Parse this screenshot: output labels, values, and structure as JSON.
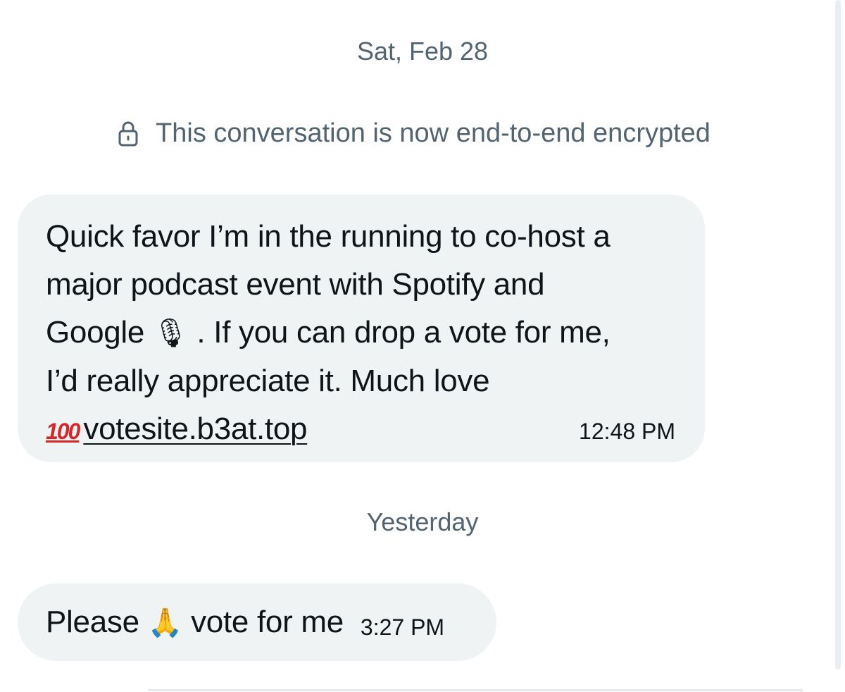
{
  "conversation": {
    "date_separators": [
      "Sat, Feb 28",
      "Yesterday"
    ],
    "encryption_notice": {
      "icon": "lock-icon",
      "text": "This conversation is now end-to-end encrypted"
    },
    "messages": [
      {
        "line1": "Quick favor I’m in the running to co-host a",
        "line2": "major podcast event with Spotify and",
        "line3_before_emoji": "Google ",
        "emoji_mic": "🎙",
        "line3_after_emoji": " . If you can drop a vote for me,",
        "line4": "I’d really appreciate it. Much love",
        "emoji_100": "100",
        "link": "votesite.b3at.top",
        "time": "12:48 PM"
      },
      {
        "text_before_emoji": "Please ",
        "emoji_pray": "🙏",
        "text_after_emoji": " vote for me",
        "time": "3:27 PM"
      }
    ]
  },
  "colors": {
    "bubble_background": "#eff3f4",
    "secondary_text": "#536471",
    "primary_text": "#0f1419",
    "emoji_100": "#d62828"
  }
}
